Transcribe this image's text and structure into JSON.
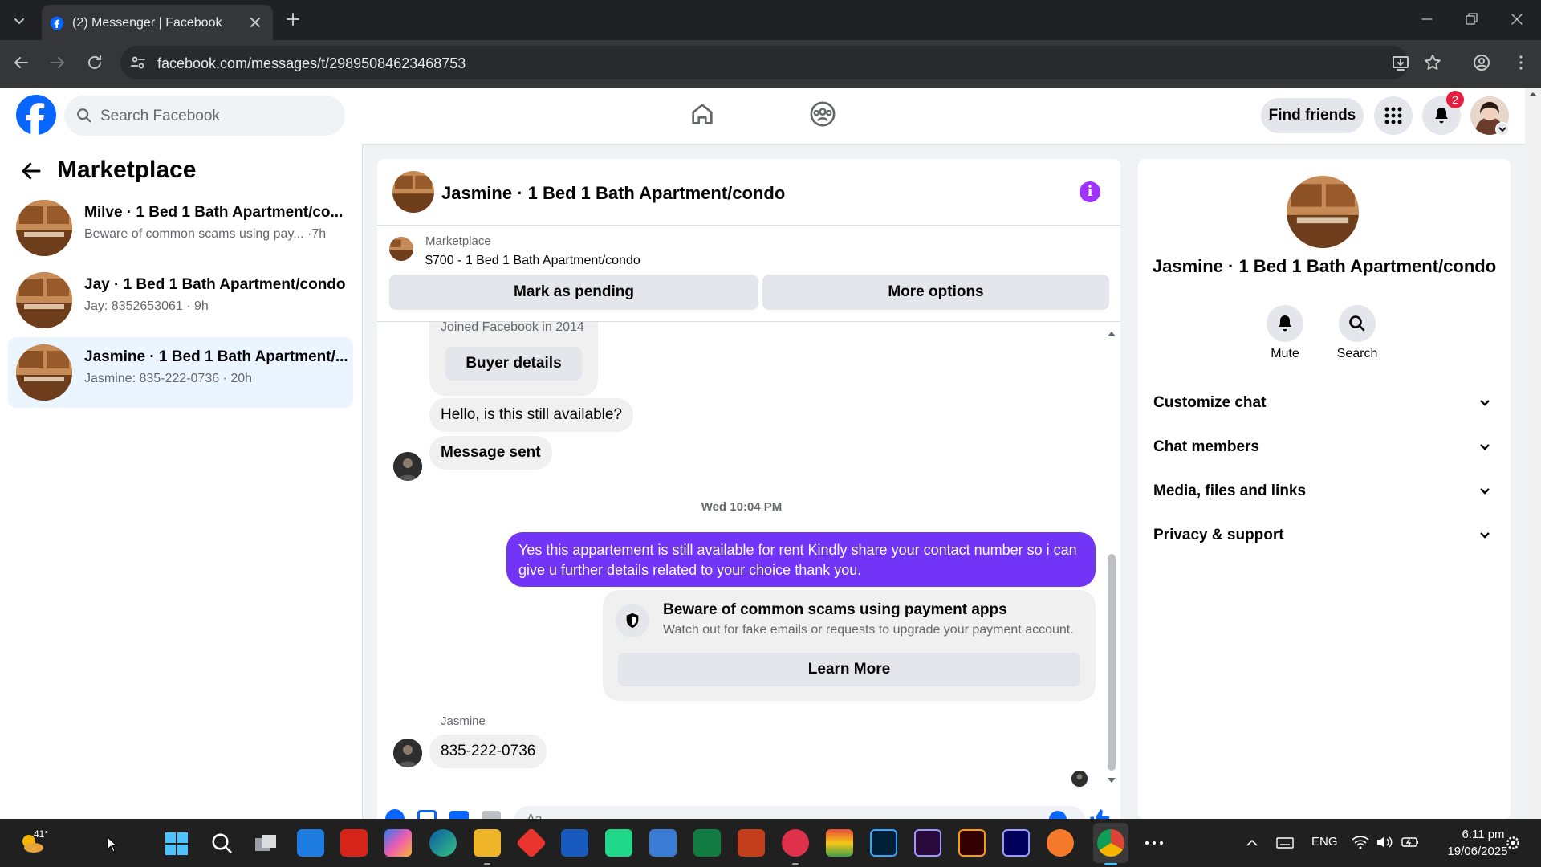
{
  "browser": {
    "tab_title": "(2) Messenger | Facebook",
    "url": "facebook.com/messages/t/29895084623468753"
  },
  "fb": {
    "search_placeholder": "Search Facebook",
    "find_friends": "Find friends",
    "notification_count": "2"
  },
  "sidebar": {
    "title": "Marketplace",
    "conversations": [
      {
        "name": "Milve · 1 Bed 1 Bath Apartment/co...",
        "preview": "Beware of common scams using pay...",
        "time": " ·7h"
      },
      {
        "name": "Jay · 1 Bed 1 Bath Apartment/condo",
        "preview": "Jay: 8352653061",
        "time": " · 9h"
      },
      {
        "name": "Jasmine · 1 Bed 1 Bath Apartment/...",
        "preview": "Jasmine: 835-222-0736",
        "time": " · 20h"
      }
    ]
  },
  "chat": {
    "title": "Jasmine · 1 Bed 1 Bath Apartment/condo",
    "listing_source": "Marketplace",
    "listing": "$700 - 1 Bed 1 Bath Apartment/condo",
    "mark_pending": "Mark as pending",
    "more_options": "More options",
    "joined": "Joined Facebook in 2014",
    "buyer_details": "Buyer details",
    "msg_available": "Hello, is this still available?",
    "msg_sent": "Message sent",
    "timestamp": "Wed 10:04 PM",
    "outgoing": "Yes this appartement is still available for rent Kindly share your contact number so i can give u further details related to your choice thank you.",
    "scam_title": "Beware of common scams using payment apps",
    "scam_body": "Watch out for fake emails or requests to upgrade your payment account.",
    "learn_more": "Learn More",
    "sender_name": "Jasmine",
    "reply": "835-222-0736",
    "composer_placeholder": "Aa"
  },
  "details": {
    "name": "Jasmine · 1 Bed 1 Bath Apartment/condo",
    "mute": "Mute",
    "search": "Search",
    "sections": [
      "Customize chat",
      "Chat members",
      "Media, files and links",
      "Privacy & support"
    ]
  },
  "taskbar": {
    "weather": "41°",
    "language": "ENG",
    "time": "6:11 pm",
    "date": "19/06/2025"
  },
  "colors": {
    "fb_blue": "#0866ff",
    "outgoing_bubble": "#7234f6",
    "info_purple": "#a033ff"
  }
}
